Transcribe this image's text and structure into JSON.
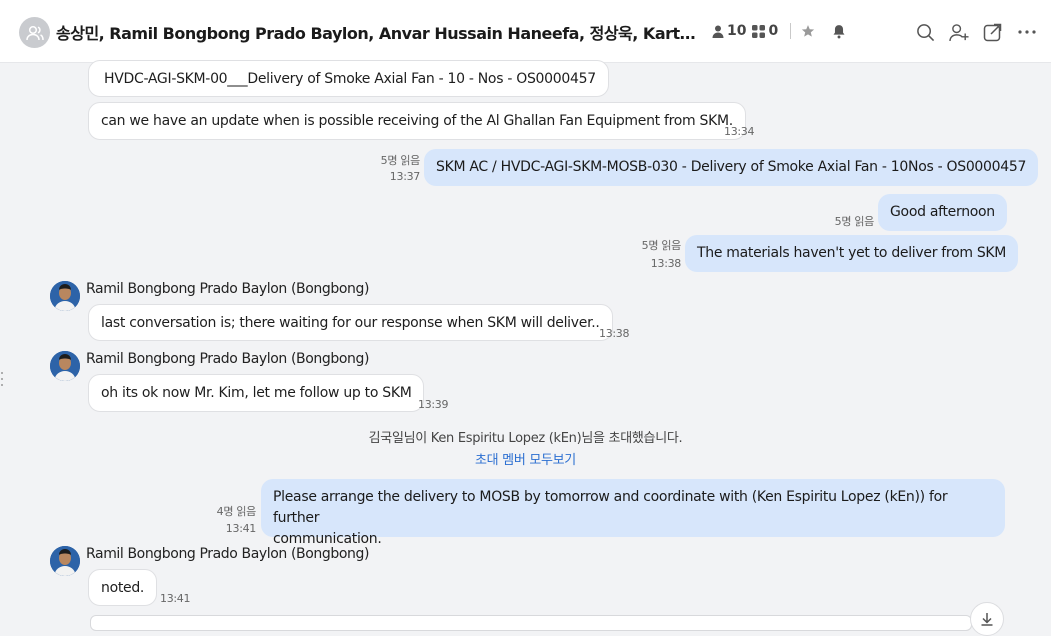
{
  "header": {
    "title": "송상민, Ramil Bongbong Prado Baylon, Anvar Hussain Haneefa, 정상욱, Karthik Raj …",
    "member_count": "10",
    "file_count": "0"
  },
  "messages": [
    {
      "type": "in",
      "text": "HVDC-AGI-SKM-00___Delivery of Smoke Axial Fan - 10 - Nos - OS0000457"
    },
    {
      "type": "in",
      "text": "can we have an update when is possible receiving of the Al Ghallan Fan Equipment from SKM.",
      "time": "13:34"
    },
    {
      "type": "out",
      "text": "SKM AC / HVDC-AGI-SKM-MOSB-030 - Delivery of Smoke Axial Fan - 10Nos - OS0000457",
      "read": "5명 읽음",
      "time": "13:37"
    },
    {
      "type": "out",
      "text": "Good afternoon",
      "read": "5명 읽음"
    },
    {
      "type": "out",
      "text": "The materials haven't yet to deliver from SKM",
      "read": "5명 읽음",
      "time": "13:38"
    },
    {
      "type": "in",
      "sender": "Ramil Bongbong Prado Baylon (Bongbong)",
      "text": "last conversation is; there waiting for our response when SKM will deliver..",
      "time": "13:38"
    },
    {
      "type": "in",
      "sender": "Ramil Bongbong Prado Baylon (Bongbong)",
      "text": "oh its ok now Mr. Kim, let me follow up to SKM",
      "time": "13:39"
    },
    {
      "type": "out",
      "text_line1": "Please arrange the delivery to MOSB by tomorrow and coordinate with (Ken Espiritu Lopez (kEn)) for further",
      "text_line2": "communication.",
      "read": "4명 읽음",
      "time": "13:41"
    },
    {
      "type": "in",
      "sender": "Ramil Bongbong Prado Baylon (Bongbong)",
      "text": "noted.",
      "time": "13:41"
    }
  ],
  "system": {
    "invite_text": "김국일님이 Ken Espiritu Lopez (kEn)님을 초대했습니다.",
    "view_all": "초대 멤버 모두보기"
  },
  "colors": {
    "outgoing_bubble": "#d7e6fb",
    "incoming_bubble": "#ffffff",
    "link": "#2c6fd1",
    "background": "#f2f3f5"
  }
}
